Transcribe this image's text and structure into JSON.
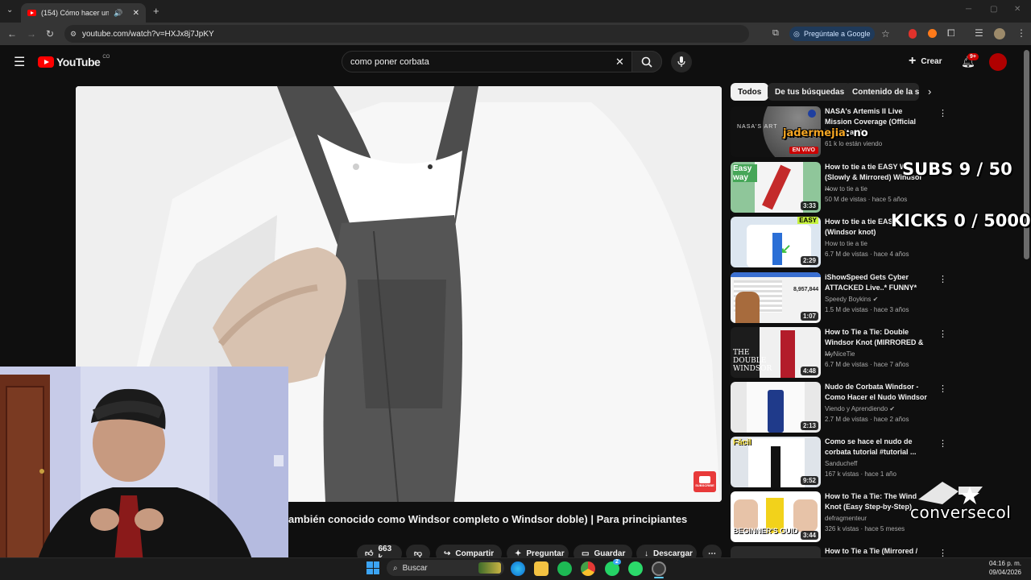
{
  "browser": {
    "tab_title": "(154) Cómo hacer un nudo",
    "new_tab": "+",
    "url": "youtube.com/watch?v=HXJx8j7JpKY",
    "gemini_label": "Pregúntale a Google"
  },
  "header": {
    "logo_text": "YouTube",
    "country": "CO",
    "search_value": "como poner corbata",
    "create_label": "Crear",
    "notif_count": "9+"
  },
  "video": {
    "title": "ambién conocido como Windsor completo o Windsor doble) | Para principiantes",
    "subscribe_badge": "SUBSCRIBE",
    "likes": "663 k",
    "actions": [
      "Compartir",
      "Preguntar",
      "Guardar",
      "Descargar"
    ]
  },
  "chips": [
    "Todos",
    "De tus búsquedas",
    "Contenido de la ser"
  ],
  "recommendations": [
    {
      "title": "NASA's Artemis II Live Mission Coverage (Official Broadcast)",
      "channel": "",
      "meta": "61 k lo están viendo",
      "live": "EN VIVO",
      "duration": "",
      "thumb_text": "NASA'S ART"
    },
    {
      "title": "How to tie a tie EASY W (Slowly & Mirrored) Windsor ...",
      "channel": "How to tie a tie",
      "meta": "50 M de vistas · hace 5 años",
      "duration": "3:33",
      "thumb_text": "Easy way"
    },
    {
      "title": "How to tie a tie EASY (Windsor knot)",
      "channel": "How to tie a tie",
      "meta": "6.7 M de vistas · hace 4 años",
      "duration": "2:29",
      "thumb_text": "EASY"
    },
    {
      "title": "iShowSpeed Gets Cyber ATTACKED Live..* FUNNY*",
      "channel": "Speedy Boykins",
      "meta": "1.5 M de vistas · hace 3 años",
      "duration": "1:07",
      "thumb_text": "8,957,844"
    },
    {
      "title": "How to Tie a Tie: Double Windsor Knot (MIRRORED & ...",
      "channel": "MyNiceTie",
      "meta": "6.7 M de vistas · hace 7 años",
      "duration": "4:48",
      "thumb_text": "THE DOUBLE WINDSOR"
    },
    {
      "title": "Nudo de Corbata Windsor - Como Hacer el Nudo Windsor",
      "channel": "Viendo y Aprendiendo",
      "meta": "2.7 M de vistas · hace 2 años",
      "duration": "2:13",
      "thumb_text": ""
    },
    {
      "title": "Como se hace el nudo de corbata tutorial #tutorial ...",
      "channel": "Sanducheff",
      "meta": "167 k vistas · hace 1 año",
      "duration": "9:52",
      "thumb_text": "Fácil"
    },
    {
      "title": "How to Tie a Tie: The Wind Knot (Easy Step-by-Step)",
      "channel": "defragmenteur",
      "meta": "326 k vistas · hace 5 meses",
      "duration": "3:44",
      "thumb_text": "BEGINNER'S GUID"
    },
    {
      "title": "How to Tie a Tie (Mirrored /",
      "channel": "",
      "meta": "",
      "duration": "",
      "thumb_text": ""
    }
  ],
  "overlay": {
    "chat_user": "jadermejia",
    "chat_msg": ": no",
    "subs": "SUBS 9 / 50",
    "kicks": "KICKS 0 / 5000",
    "brand": "conversecol"
  },
  "taskbar": {
    "search_label": "Buscar",
    "whatsapp_badge": "2",
    "time": "04:16 p. m.",
    "date": "09/04/2026"
  }
}
